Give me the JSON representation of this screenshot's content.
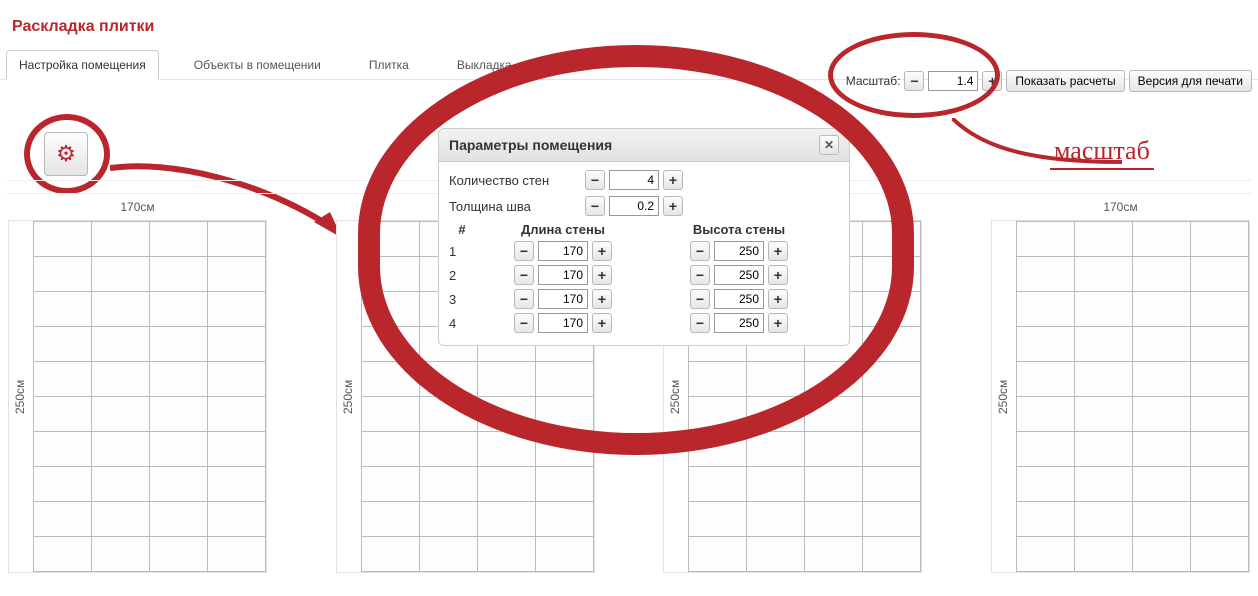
{
  "title": "Раскладка плитки",
  "tabs": [
    {
      "label": "Настройка помещения",
      "active": true
    },
    {
      "label": "Объекты в помещении",
      "active": false
    },
    {
      "label": "Плитка",
      "active": false
    },
    {
      "label": "Выкладка",
      "active": false
    }
  ],
  "toolbar": {
    "scale_label": "Масштаб:",
    "scale_value": "1.4",
    "show_calc": "Показать расчеты",
    "print_version": "Версия для печати"
  },
  "dialog": {
    "title": "Параметры помещения",
    "walls_count_label": "Количество стен",
    "walls_count": "4",
    "seam_label": "Толщина шва",
    "seam_value": "0.2",
    "col_hash": "#",
    "col_len": "Длина стены",
    "col_h": "Высота стены",
    "rows": [
      {
        "idx": "1",
        "len": "170",
        "h": "250"
      },
      {
        "idx": "2",
        "len": "170",
        "h": "250"
      },
      {
        "idx": "3",
        "len": "170",
        "h": "250"
      },
      {
        "idx": "4",
        "len": "170",
        "h": "250"
      }
    ]
  },
  "walls": {
    "width_label": "170см",
    "height_label": "250см"
  },
  "annotation": {
    "scale": "масштаб"
  },
  "glyph": {
    "plus": "+",
    "minus": "−",
    "close": "✕",
    "gear": "⚙"
  }
}
